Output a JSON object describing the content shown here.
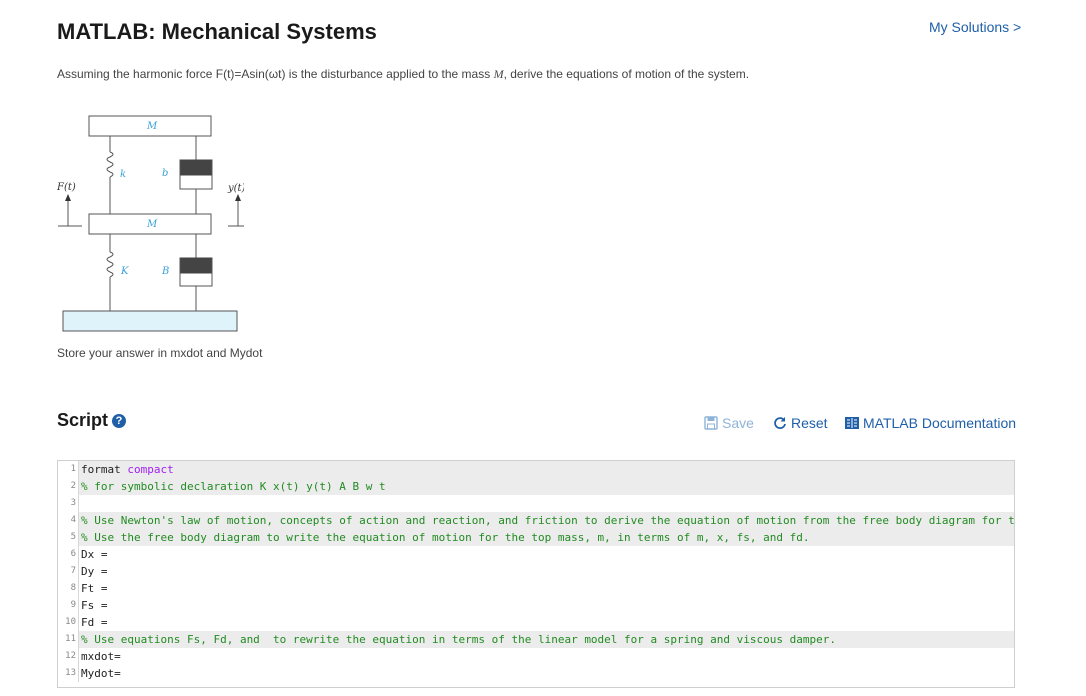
{
  "page": {
    "title": "MATLAB: Mechanical Systems",
    "my_solutions": "My Solutions >",
    "prompt_before": "Assuming the harmonic force F(t)=Asin(ωt) is the disturbance applied to the mass ",
    "prompt_mass": "M",
    "prompt_after": ", derive the equations of motion of the system.",
    "store_text": "Store your answer in mxdot and Mydot"
  },
  "diagram": {
    "top_mass": "M",
    "bottom_mass": "M",
    "k": "k",
    "b": "b",
    "K": "K",
    "B": "B",
    "force": "F(t)",
    "disp": "y(t)"
  },
  "script": {
    "title": "Script",
    "save": "Save",
    "reset": "Reset",
    "doc": "MATLAB Documentation",
    "lines": [
      {
        "n": "1",
        "text": "format ",
        "extra": "compact",
        "shaded": true
      },
      {
        "n": "2",
        "text": "% for symbolic declaration K x(t) y(t) A B w t",
        "shaded": true
      },
      {
        "n": "3",
        "text": "",
        "shaded": false
      },
      {
        "n": "4",
        "text": "% Use Newton's law of motion, concepts of action and reaction, and friction to derive the equation of motion from the free body diagram for the ma",
        "shaded": true
      },
      {
        "n": "5",
        "text": "% Use the free body diagram to write the equation of motion for the top mass, m, in terms of m, x, fs, and fd.",
        "shaded": true
      },
      {
        "n": "6",
        "text": "Dx =",
        "shaded": false
      },
      {
        "n": "7",
        "text": "Dy =",
        "shaded": false
      },
      {
        "n": "8",
        "text": "Ft =",
        "shaded": false
      },
      {
        "n": "9",
        "text": "Fs =",
        "shaded": false
      },
      {
        "n": "10",
        "text": "Fd =",
        "shaded": false
      },
      {
        "n": "11",
        "text": "% Use equations Fs, Fd, and  to rewrite the equation in terms of the linear model for a spring and viscous damper.",
        "shaded": true
      },
      {
        "n": "12",
        "text": "mxdot=",
        "shaded": false
      },
      {
        "n": "13",
        "text": "Mydot=",
        "shaded": false
      }
    ]
  },
  "colors": {
    "link": "#1f5fa8",
    "comment": "#228b22",
    "ground": "#dff3fb"
  }
}
